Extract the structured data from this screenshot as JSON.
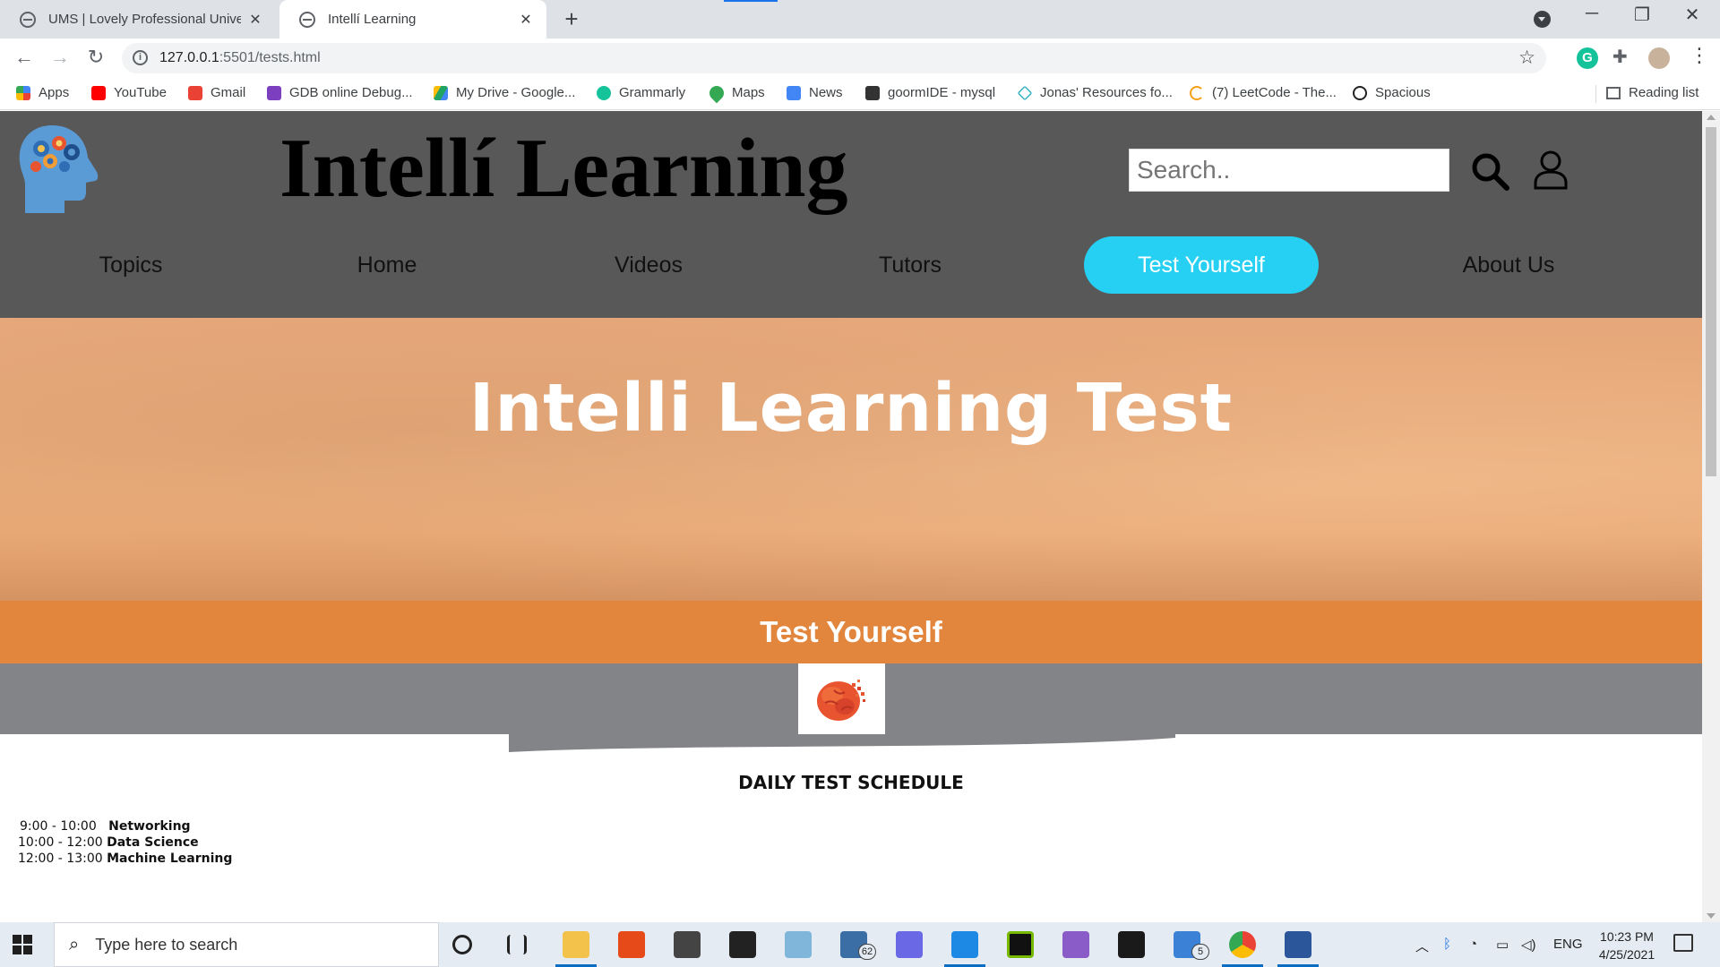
{
  "browser": {
    "tabs": [
      {
        "title": "UMS | Lovely Professional Univer",
        "active": false
      },
      {
        "title": "Intellí Learning",
        "active": true
      }
    ],
    "url_host": "127.0.0.1",
    "url_rest": ":5501/tests.html",
    "bookmarks": [
      {
        "label": "Apps",
        "color": "#4285f4"
      },
      {
        "label": "YouTube",
        "color": "#ff0000"
      },
      {
        "label": "Gmail",
        "color": "#ea4335"
      },
      {
        "label": "GDB online Debug...",
        "color": "#7b3fc0"
      },
      {
        "label": "My Drive - Google...",
        "color": "#1fa463"
      },
      {
        "label": "Grammarly",
        "color": "#15c39a"
      },
      {
        "label": "Maps",
        "color": "#34a853"
      },
      {
        "label": "News",
        "color": "#4285f4"
      },
      {
        "label": "goormIDE - mysql",
        "color": "#333333"
      },
      {
        "label": "Jonas' Resources fo...",
        "color": "#37b3c8"
      },
      {
        "label": "(7) LeetCode - The...",
        "color": "#f89f1b"
      },
      {
        "label": "Spacious",
        "color": "#222222"
      }
    ],
    "reading_list": "Reading list"
  },
  "site": {
    "title": "Intellí Learning",
    "search_placeholder": "Search..",
    "nav": [
      {
        "label": "Topics",
        "active": false
      },
      {
        "label": "Home",
        "active": false
      },
      {
        "label": "Videos",
        "active": false
      },
      {
        "label": "Tutors",
        "active": false
      },
      {
        "label": "Test Yourself",
        "active": true
      },
      {
        "label": "About Us",
        "active": false
      }
    ],
    "hero_title": "Intelli Learning Test",
    "section_title": "Test Yourself",
    "schedule_title": "DAILY TEST SCHEDULE",
    "schedule": [
      {
        "time": "9:00 - 10:00",
        "subject": "Networking"
      },
      {
        "time": "10:00 - 12:00",
        "subject": "Data Science"
      },
      {
        "time": "12:00 - 13:00",
        "subject": "Machine Learning"
      }
    ],
    "colors": {
      "header_bg": "#585858",
      "active_nav": "#26d0f2",
      "hero": "#e8aa78",
      "section_band": "#e2863e",
      "grey_band": "#838487"
    }
  },
  "taskbar": {
    "search_placeholder": "Type here to search",
    "mail_count": "62",
    "todo_count": "5",
    "language": "ENG",
    "time": "10:23 PM",
    "date": "4/25/2021"
  }
}
